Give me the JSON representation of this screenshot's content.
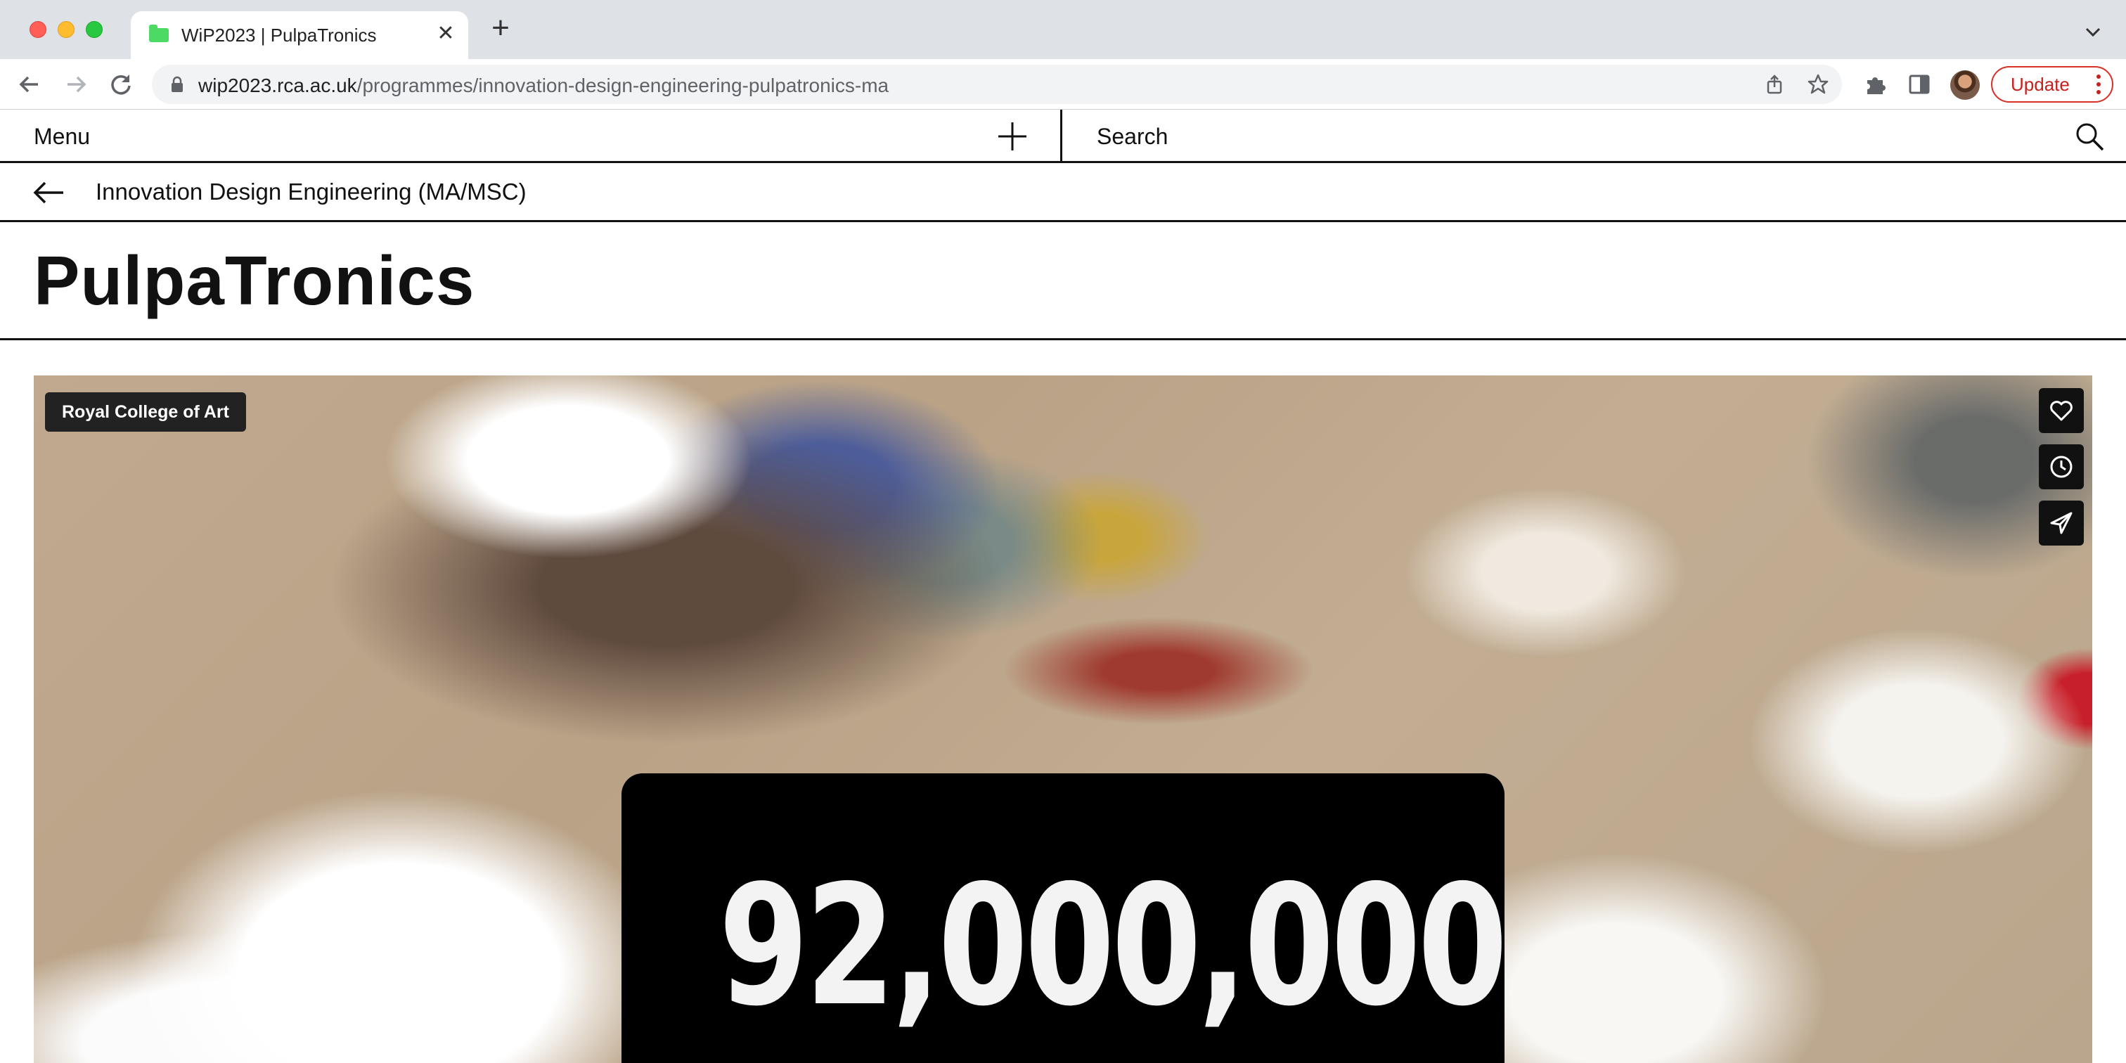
{
  "browser": {
    "tab": {
      "title": "WiP2023 | PulpaTronics",
      "favicon": "folder-icon"
    },
    "url": {
      "host": "wip2023.rca.ac.uk",
      "path": "/programmes/innovation-design-engineering-pulpatronics-ma"
    },
    "update_label": "Update"
  },
  "header": {
    "menu_label": "Menu",
    "search_label": "Search"
  },
  "breadcrumb": {
    "label": "Innovation Design Engineering (MA/MSC)"
  },
  "page": {
    "title": "PulpaTronics"
  },
  "hero": {
    "badge": "Royal College of Art",
    "stat": "92,000,000",
    "actions": [
      "heart-icon",
      "clock-icon",
      "send-icon"
    ]
  },
  "colors": {
    "tabbar_bg": "#dee1e6",
    "update_red": "#d93025",
    "text": "#111111"
  }
}
